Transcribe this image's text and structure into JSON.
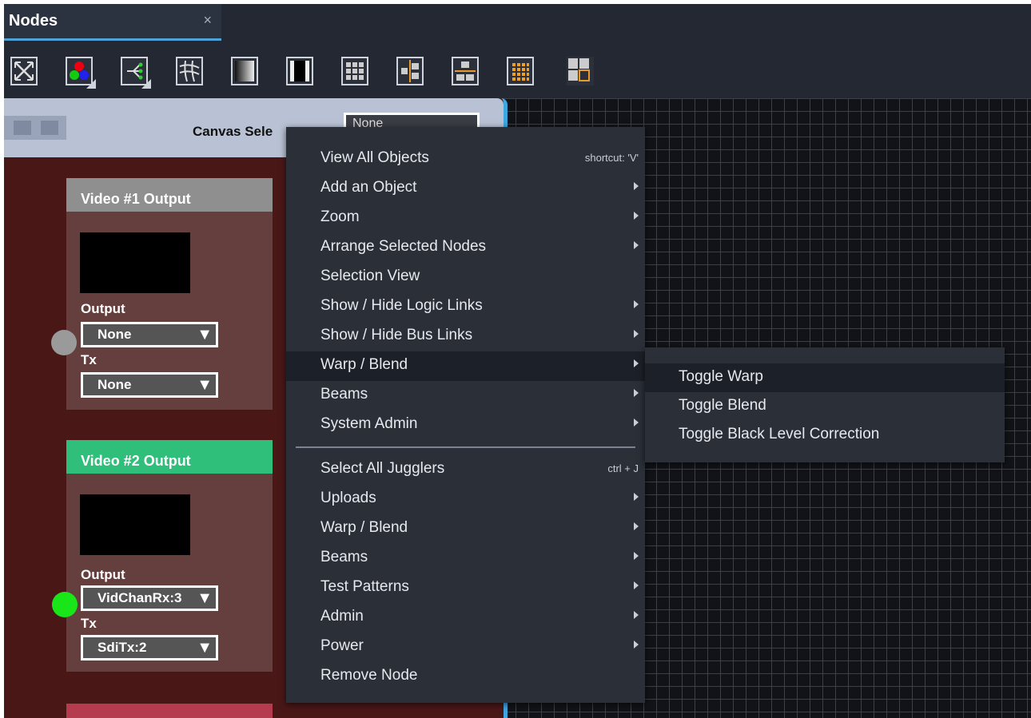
{
  "tab": {
    "title": "Nodes",
    "close": "×"
  },
  "toolbar": {
    "buttons": [
      "fit-view-icon",
      "rgb-color-icon",
      "link-tree-icon",
      "warp-grid-icon",
      "gradient-icon",
      "black-level-icon",
      "grid-3x3-icon",
      "layout-center-icon",
      "layout-split-icon",
      "grid-orange-icon",
      "layout-quad-icon"
    ]
  },
  "panel": {
    "canvas_select_label": "Canvas Sele",
    "canvas_select_value": "None"
  },
  "nodes": [
    {
      "title": "Video #1 Output",
      "title_color": "#8f8f8f",
      "output_label": "Output",
      "output_value": "None",
      "tx_label": "Tx",
      "tx_value": "None",
      "status_color": "#9a9a9a"
    },
    {
      "title": "Video #2 Output",
      "title_color": "#2fbf7a",
      "output_label": "Output",
      "output_value": "VidChanRx:3",
      "tx_label": "Tx",
      "tx_value": "SdiTx:2",
      "status_color": "#19e619"
    }
  ],
  "menu": {
    "items": [
      {
        "label": "View All Objects",
        "shortcut": "shortcut: 'V'"
      },
      {
        "label": "Add an Object",
        "submenu": true
      },
      {
        "label": "Zoom",
        "submenu": true
      },
      {
        "label": "Arrange Selected Nodes",
        "submenu": true
      },
      {
        "label": "Selection View"
      },
      {
        "label": "Show / Hide Logic Links",
        "submenu": true
      },
      {
        "label": "Show / Hide Bus Links",
        "submenu": true
      },
      {
        "label": "Warp / Blend",
        "submenu": true,
        "active": true
      },
      {
        "label": "Beams",
        "submenu": true
      },
      {
        "label": "System Admin",
        "submenu": true
      },
      {
        "label": "Select All Jugglers",
        "shortcut": "ctrl + J"
      },
      {
        "label": "Uploads",
        "submenu": true
      },
      {
        "label": "Warp / Blend",
        "submenu": true
      },
      {
        "label": "Beams",
        "submenu": true
      },
      {
        "label": "Test Patterns",
        "submenu": true
      },
      {
        "label": "Admin",
        "submenu": true
      },
      {
        "label": "Power",
        "submenu": true
      },
      {
        "label": "Remove Node"
      }
    ]
  },
  "submenu": {
    "items": [
      {
        "label": "Toggle Warp"
      },
      {
        "label": "Toggle Blend"
      },
      {
        "label": "Toggle Black Level Correction"
      }
    ]
  }
}
